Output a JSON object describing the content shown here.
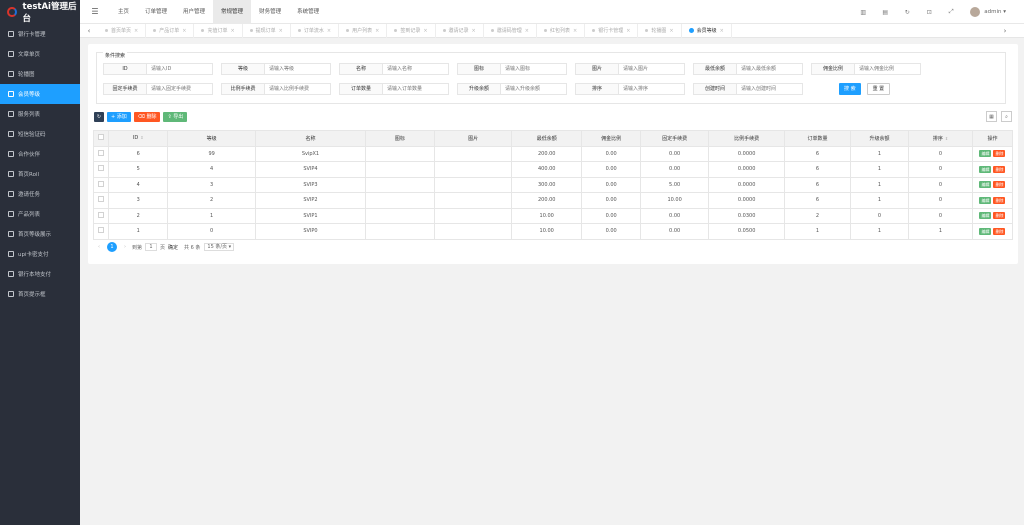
{
  "app": {
    "title": "testAi管理后台"
  },
  "sidebar": {
    "items": [
      {
        "label": "银行卡管理"
      },
      {
        "label": "文章单页"
      },
      {
        "label": "轮播图"
      },
      {
        "label": "会员等级"
      },
      {
        "label": "服务列表"
      },
      {
        "label": "短信验证码"
      },
      {
        "label": "合作伙伴"
      },
      {
        "label": "首页Roll"
      },
      {
        "label": "邀请任务"
      },
      {
        "label": "产品列表"
      },
      {
        "label": "首页等级展示"
      },
      {
        "label": "upi卡密支付"
      },
      {
        "label": "银行本地支付"
      },
      {
        "label": "首页提示框"
      }
    ],
    "active_index": 3
  },
  "topnav": {
    "items": [
      {
        "label": "主页"
      },
      {
        "label": "订单管理"
      },
      {
        "label": "用户管理"
      },
      {
        "label": "常规管理"
      },
      {
        "label": "财务管理"
      },
      {
        "label": "系统管理"
      }
    ],
    "active_index": 3
  },
  "user": {
    "name": "admin ▾"
  },
  "tabs": [
    {
      "label": "首页单页"
    },
    {
      "label": "产品订单"
    },
    {
      "label": "充值订单"
    },
    {
      "label": "提现订单"
    },
    {
      "label": "订单流水"
    },
    {
      "label": "用户列表"
    },
    {
      "label": "签到记录"
    },
    {
      "label": "邀请记录"
    },
    {
      "label": "邀请码管理"
    },
    {
      "label": "红包列表"
    },
    {
      "label": "银行卡管理"
    },
    {
      "label": "轮播图"
    },
    {
      "label": "会员等级"
    }
  ],
  "filter": {
    "title": "条件搜索",
    "fields": [
      {
        "label": "ID",
        "placeholder": "请输入ID"
      },
      {
        "label": "等级",
        "placeholder": "请输入等级"
      },
      {
        "label": "名称",
        "placeholder": "请输入名称"
      },
      {
        "label": "图标",
        "placeholder": "请输入图标"
      },
      {
        "label": "图片",
        "placeholder": "请输入图片"
      },
      {
        "label": "最低余额",
        "placeholder": "请输入最低余额"
      },
      {
        "label": "佣金比例",
        "placeholder": "请输入佣金比例"
      },
      {
        "label": "固定手续费",
        "placeholder": "请输入固定手续费"
      },
      {
        "label": "比例手续费",
        "placeholder": "请输入比例手续费"
      },
      {
        "label": "订单数量",
        "placeholder": "请输入订单数量"
      },
      {
        "label": "升级余额",
        "placeholder": "请输入升级余额"
      },
      {
        "label": "排序",
        "placeholder": "请输入排序"
      },
      {
        "label": "创建时间",
        "placeholder": "请输入创建时间"
      }
    ],
    "search_label": "搜 索",
    "reset_label": "重 置"
  },
  "toolbar": {
    "add_label": "+ 添加",
    "delete_label": "删除",
    "export_label": "导出"
  },
  "table": {
    "headers": [
      "ID",
      "等级",
      "名称",
      "图标",
      "图片",
      "最低余额",
      "佣金比例",
      "固定手续费",
      "比例手续费",
      "订单数量",
      "升级余额",
      "排序",
      "操作"
    ],
    "rows": [
      [
        "6",
        "99",
        "SvipX1",
        "",
        "",
        "200.00",
        "0.00",
        "0.00",
        "0.0000",
        "6",
        "1",
        "0"
      ],
      [
        "5",
        "4",
        "SVIP4",
        "",
        "",
        "400.00",
        "0.00",
        "0.00",
        "0.0000",
        "6",
        "1",
        "0"
      ],
      [
        "4",
        "3",
        "SVIP3",
        "",
        "",
        "300.00",
        "0.00",
        "5.00",
        "0.0000",
        "6",
        "1",
        "0"
      ],
      [
        "3",
        "2",
        "SVIP2",
        "",
        "",
        "200.00",
        "0.00",
        "10.00",
        "0.0000",
        "6",
        "1",
        "0"
      ],
      [
        "2",
        "1",
        "SVIP1",
        "",
        "",
        "10.00",
        "0.00",
        "0.00",
        "0.0300",
        "2",
        "0",
        "0"
      ],
      [
        "1",
        "0",
        "SVIP0",
        "",
        "",
        "10.00",
        "0.00",
        "0.00",
        "0.0500",
        "1",
        "1",
        "1"
      ]
    ],
    "edit_label": "编辑",
    "delete_label": "删除"
  },
  "pager": {
    "current": "1",
    "goto_label": "到第",
    "page_input": "1",
    "page_unit": "页",
    "confirm_label": "确定",
    "total": "共 6 条",
    "page_size": "15 条/页"
  }
}
